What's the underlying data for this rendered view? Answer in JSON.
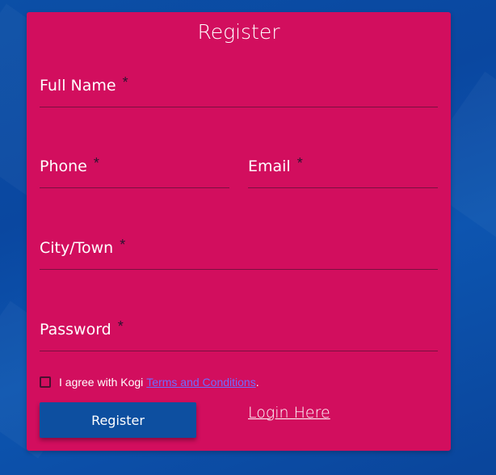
{
  "form": {
    "title": "Register",
    "required_mark": "*",
    "fields": {
      "full_name": "Full Name",
      "phone": "Phone",
      "email": "Email",
      "city": "City/Town",
      "password": "Password"
    },
    "agree_text": "I agree with Kogi",
    "terms_link": "Terms and Conditions",
    "agree_suffix": ".",
    "submit_label": "Register",
    "login_link": "Login Here"
  },
  "colors": {
    "background": "#0b4fa6",
    "card": "#d20e5e",
    "button": "#0d4fa0",
    "link": "#6f6cff"
  }
}
